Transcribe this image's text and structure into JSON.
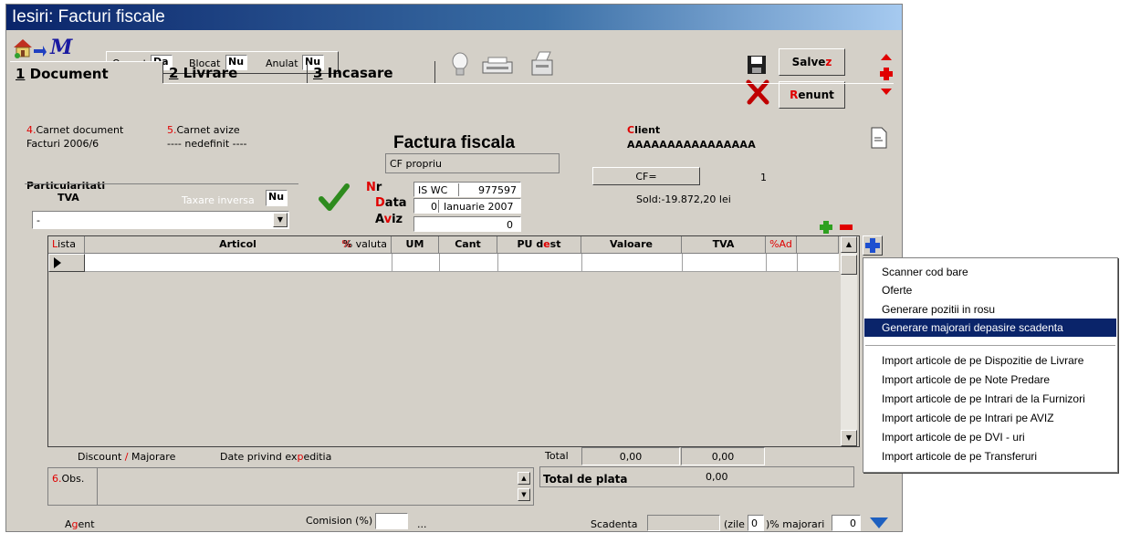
{
  "window": {
    "title": "Iesiri: Facturi fiscale"
  },
  "toolbar": {
    "operat_label": "Operat",
    "operat_value": "Da",
    "blocat_label": "Blocat",
    "blocat_value": "Nu",
    "anulat_label": "Anulat",
    "anulat_value": "Nu",
    "save_first": "Salve",
    "save_last": "z",
    "cancel_first": "R",
    "cancel_rest": "enunt"
  },
  "tabs": [
    {
      "num": "1",
      "label": "Document"
    },
    {
      "num": "2",
      "label": "Livrare"
    },
    {
      "num": "3",
      "label": "Incasare"
    }
  ],
  "document": {
    "carnet_doc_num": "4.",
    "carnet_doc_label": "Carnet document",
    "carnet_doc_value": "Facturi 2006/6",
    "carnet_avize_num": "5.",
    "carnet_avize_label": "Carnet avize",
    "carnet_avize_value": "---- nedefinit ----",
    "title": "Factura fiscala",
    "cf_field": "CF propriu",
    "nr_first": "N",
    "nr_rest": "r",
    "nr_series": "IS WC",
    "nr_value": "977597",
    "data_first": "D",
    "data_rest": "ata",
    "data_day": "0",
    "data_value": "Ianuarie 2007",
    "aviz_first": "A",
    "aviz_mid": "v",
    "aviz_rest": "iz",
    "aviz_value": "0",
    "particularitati_line1": "Particularitati",
    "particularitati_line2": "TVA",
    "taxare_label": "Taxare inversa",
    "taxare_value": "Nu",
    "particularitati_select": "-"
  },
  "client": {
    "label_first": "C",
    "label_rest": "lient",
    "name": "AAAAAAAAAAAAAAAA",
    "cf_button": "CF=",
    "cf_count": "1",
    "sold": "Sold:-19.872,20 lei"
  },
  "grid": {
    "headers": {
      "lista_first": "L",
      "lista_rest": "ista",
      "articol": "Articol",
      "valuta": "% valuta",
      "um": "UM",
      "cant": "Cant",
      "pu_first": "PU d",
      "pu_red": "e",
      "pu_rest": "st",
      "valoare": "Valoare",
      "tva": "TVA",
      "ad": "%Ad"
    }
  },
  "footer": {
    "discount_a": "Discount ",
    "discount_slash": "/",
    "discount_b": " Majorare",
    "expeditie_a": "Date privind ex",
    "expeditie_red": "p",
    "expeditie_b": "editia",
    "total_label": "Total",
    "total_valoare": "0,00",
    "total_tva": "0,00",
    "total_plata_label": "Total de plata",
    "total_plata_value": "0,00",
    "obs_num": "6.",
    "obs_label": "Obs.",
    "agent_a": "A",
    "agent_red": "g",
    "agent_b": "ent",
    "comision_label": "Comision (%)",
    "comision_dots": "...",
    "scadenta_label": "Scadenta",
    "zile_label": "(zile",
    "zile_value": "0",
    "majorari_label": ")% majorari",
    "majorari_value": "0"
  },
  "menu": {
    "items_top": [
      "Scanner cod bare",
      "Oferte",
      "Generare pozitii in rosu",
      "Generare majorari depasire scadenta"
    ],
    "selected_index": 3,
    "items_bottom": [
      "Import articole de pe Dispozitie de Livrare",
      "Import articole de pe Note Predare",
      "Import articole de pe Intrari de la Furnizori",
      "Import articole de pe Intrari pe AVIZ",
      "Import articole de pe DVI - uri",
      "Import articole de pe Transferuri"
    ]
  },
  "colors": {
    "accent_red": "#e00000",
    "title_blue": "#0a246a",
    "check_green": "#2e8b1e"
  }
}
